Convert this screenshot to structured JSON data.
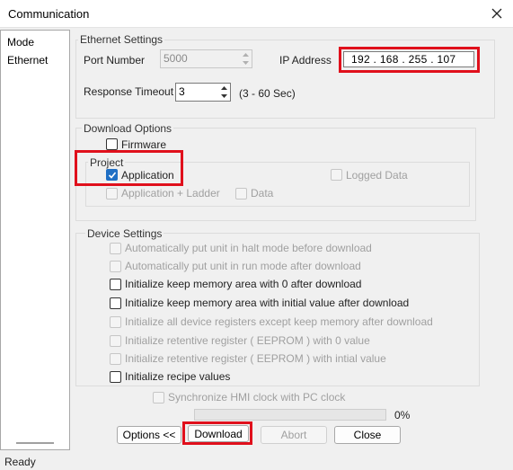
{
  "window": {
    "title": "Communication"
  },
  "sidebar": {
    "items": [
      "Mode",
      "Ethernet"
    ]
  },
  "ethernet": {
    "group_label": "Ethernet Settings",
    "port_label": "Port Number",
    "port_value": "5000",
    "ip_label": "IP Address",
    "ip_value": "192 . 168 . 255 . 107",
    "timeout_label": "Response Timeout",
    "timeout_value": "3",
    "timeout_hint": "(3 - 60 Sec)"
  },
  "download_options": {
    "group_label": "Download Options",
    "firmware_label": "Firmware",
    "project_label": "Project",
    "application_label": "Application",
    "logged_data_label": "Logged Data",
    "app_ladder_label": "Application + Ladder",
    "data_label": "Data"
  },
  "device_settings": {
    "group_label": "Device Settings",
    "items": [
      "Automatically put unit in halt mode before download",
      "Automatically put unit in run mode after download",
      "Initialize keep memory area with 0 after download",
      "Initialize keep memory area with initial value after download",
      "Initialize all device registers except keep memory after download",
      "Initialize retentive register  ( EEPROM ) with 0 value",
      "Initialize retentive register ( EEPROM ) with intial value",
      "Initialize recipe values"
    ]
  },
  "sync_label": "Synchronize HMI clock with PC clock",
  "progress": {
    "value": 0,
    "text": "0%"
  },
  "buttons": {
    "options": "Options <<",
    "download": "Download",
    "abort": "Abort",
    "close": "Close"
  },
  "status": "Ready",
  "colors": {
    "highlight": "#e0101c",
    "check_accent": "#1f6fc4"
  }
}
